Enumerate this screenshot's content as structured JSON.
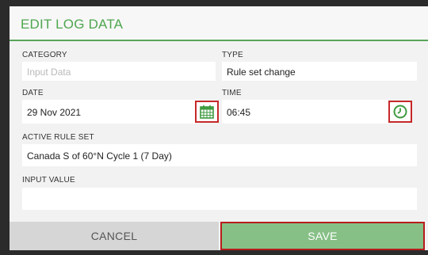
{
  "dialog": {
    "title": "EDIT LOG DATA"
  },
  "fields": {
    "category": {
      "label": "CATEGORY",
      "value": "",
      "placeholder": "Input Data"
    },
    "type": {
      "label": "TYPE",
      "value": "Rule set change"
    },
    "date": {
      "label": "DATE",
      "value": "29 Nov 2021",
      "icon": "calendar-icon"
    },
    "time": {
      "label": "TIME",
      "value": "06:45",
      "icon": "clock-icon"
    },
    "active_rule_set": {
      "label": "ACTIVE RULE SET",
      "value": "Canada S of 60°N Cycle 1 (7 Day)"
    },
    "input_value": {
      "label": "INPUT VALUE",
      "value": ""
    }
  },
  "footer": {
    "cancel_label": "CANCEL",
    "save_label": "SAVE"
  },
  "colors": {
    "accent_green": "#4fa64f",
    "highlight_red": "#c62828",
    "save_bg": "#86c086"
  }
}
